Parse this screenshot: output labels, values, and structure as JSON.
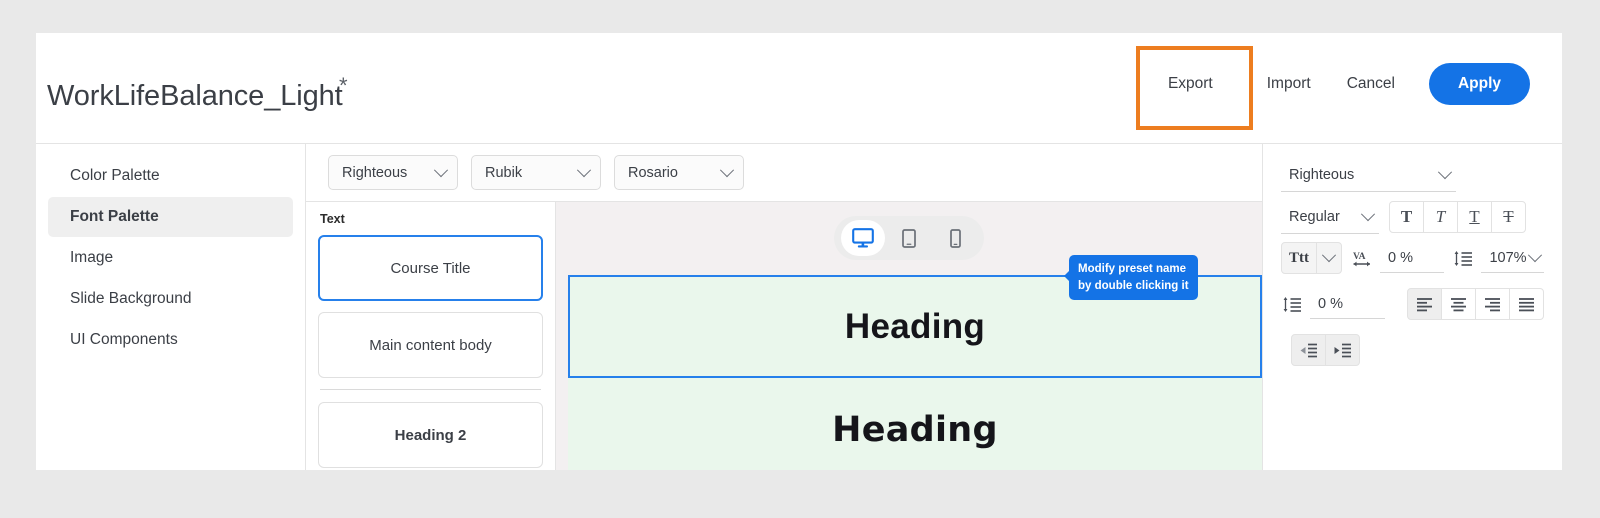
{
  "header": {
    "document_title": "WorkLifeBalance_Light",
    "unsaved_marker": "*",
    "export_label": "Export",
    "import_label": "Import",
    "cancel_label": "Cancel",
    "apply_label": "Apply",
    "highlight_color": "#ed7d1f",
    "apply_color": "#1473e6"
  },
  "sidebar": {
    "items": [
      {
        "label": "Color Palette"
      },
      {
        "label": "Font Palette"
      },
      {
        "label": "Image"
      },
      {
        "label": "Slide Background"
      },
      {
        "label": "UI Components"
      }
    ],
    "active_index": 1
  },
  "fontbar": {
    "selects": [
      {
        "value": "Righteous"
      },
      {
        "value": "Rubik"
      },
      {
        "value": "Rosario"
      }
    ]
  },
  "presets": {
    "section_label": "Text",
    "cards": [
      {
        "label": "Course Title",
        "selected": true
      },
      {
        "label": "Main content body",
        "selected": false
      },
      {
        "label": "Heading 2",
        "selected": false
      }
    ]
  },
  "tooltip": {
    "line1": "Modify preset name",
    "line2": "by double clicking it"
  },
  "preview": {
    "devices": [
      {
        "name": "desktop-icon",
        "active": true
      },
      {
        "name": "tablet-icon",
        "active": false
      },
      {
        "name": "mobile-icon",
        "active": false
      }
    ],
    "blocks": [
      {
        "text": "Heading",
        "selected": true
      },
      {
        "text": "Heading",
        "selected": false
      }
    ],
    "canvas_color": "#eaf7ec"
  },
  "properties": {
    "font_family": "Righteous",
    "font_weight": "Regular",
    "style_buttons": [
      {
        "name": "bold-button",
        "glyph": "T",
        "active": false
      },
      {
        "name": "italic-button",
        "glyph": "T",
        "active": false
      },
      {
        "name": "underline-button",
        "glyph": "T",
        "active": false
      },
      {
        "name": "strikethrough-button",
        "glyph": "T",
        "active": false
      }
    ],
    "text_case_label": "Ttt",
    "letter_spacing": "0 %",
    "line_height": "107%",
    "paragraph_spacing": "0 %",
    "alignment": [
      "left",
      "center",
      "right",
      "justify"
    ],
    "alignment_active": 0,
    "indent_buttons": [
      "outdent",
      "indent"
    ],
    "indent_active": 1
  }
}
